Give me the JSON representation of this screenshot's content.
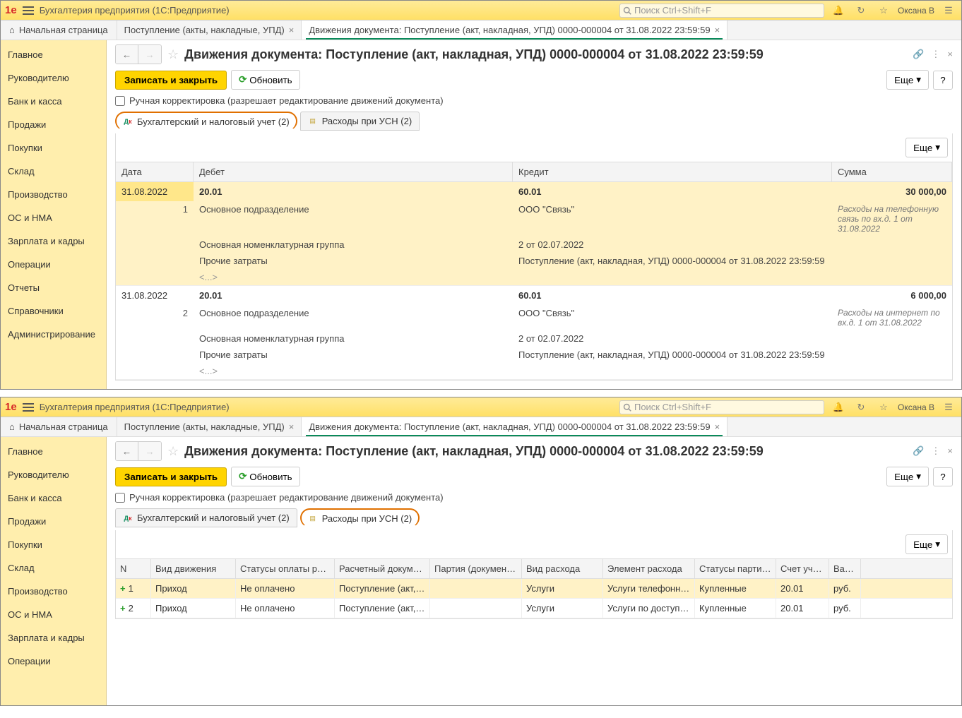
{
  "app": {
    "title": "Бухгалтерия предприятия  (1С:Предприятие)",
    "search_placeholder": "Поиск Ctrl+Shift+F",
    "user": "Оксана В"
  },
  "tabs": {
    "home": "Начальная страница",
    "t1": "Поступление (акты, накладные, УПД)",
    "t2": "Движения документа: Поступление (акт, накладная, УПД) 0000-000004 от 31.08.2022 23:59:59"
  },
  "sidebar": {
    "items": [
      "Главное",
      "Руководителю",
      "Банк и касса",
      "Продажи",
      "Покупки",
      "Склад",
      "Производство",
      "ОС и НМА",
      "Зарплата и кадры",
      "Операции",
      "Отчеты",
      "Справочники",
      "Администрирование"
    ]
  },
  "page": {
    "title": "Движения документа: Поступление (акт, накладная, УПД) 0000-000004 от 31.08.2022 23:59:59",
    "save_close": "Записать и закрыть",
    "refresh": "Обновить",
    "more": "Еще",
    "help": "?",
    "manual_edit": "Ручная корректировка (разрешает редактирование движений документа)",
    "tab_acc": "Бухгалтерский и налоговый учет (2)",
    "tab_usn": "Расходы при УСН (2)"
  },
  "grid": {
    "headers": {
      "date": "Дата",
      "debit": "Дебет",
      "credit": "Кредит",
      "sum": "Сумма"
    },
    "entries": [
      {
        "date": "31.08.2022",
        "num": "1",
        "debit_acc": "20.01",
        "credit_acc": "60.01",
        "sum": "30 000,00",
        "desc": "Расходы на телефонную связь по вх.д. 1 от 31.08.2022",
        "lines": [
          {
            "d": "Основное подразделение",
            "c": "ООО \"Связь\""
          },
          {
            "d": "Основная номенклатурная группа",
            "c": "2 от 02.07.2022"
          },
          {
            "d": "Прочие затраты",
            "c": "Поступление (акт, накладная, УПД) 0000-000004 от 31.08.2022 23:59:59"
          },
          {
            "d": "<...>",
            "c": ""
          }
        ]
      },
      {
        "date": "31.08.2022",
        "num": "2",
        "debit_acc": "20.01",
        "credit_acc": "60.01",
        "sum": "6 000,00",
        "desc": "Расходы на интернет по вх.д. 1 от 31.08.2022",
        "lines": [
          {
            "d": "Основное подразделение",
            "c": "ООО \"Связь\""
          },
          {
            "d": "Основная номенклатурная группа",
            "c": "2 от 02.07.2022"
          },
          {
            "d": "Прочие затраты",
            "c": "Поступление (акт, накладная, УПД) 0000-000004 от 31.08.2022 23:59:59"
          },
          {
            "d": "<...>",
            "c": ""
          }
        ]
      }
    ]
  },
  "grid2": {
    "headers": {
      "n": "N",
      "kind": "Вид движения",
      "stat": "Статусы оплаты рас...",
      "doc": "Расчетный документ",
      "party": "Партия (документ ...",
      "vras": "Вид расхода",
      "elras": "Элемент расхода",
      "stp": "Статусы партий ...",
      "acc": "Счет учета",
      "cur": "Вал..."
    },
    "rows": [
      {
        "n": "1",
        "kind": "Приход",
        "stat": "Не оплачено",
        "doc": "Поступление (акт, ...",
        "party": "",
        "vras": "Услуги",
        "elras": "Услуги телефонно...",
        "stp": "Купленные",
        "acc": "20.01",
        "cur": "руб."
      },
      {
        "n": "2",
        "kind": "Приход",
        "stat": "Не оплачено",
        "doc": "Поступление (акт, ...",
        "party": "",
        "vras": "Услуги",
        "elras": "Услуги по доступу...",
        "stp": "Купленные",
        "acc": "20.01",
        "cur": "руб."
      }
    ]
  }
}
